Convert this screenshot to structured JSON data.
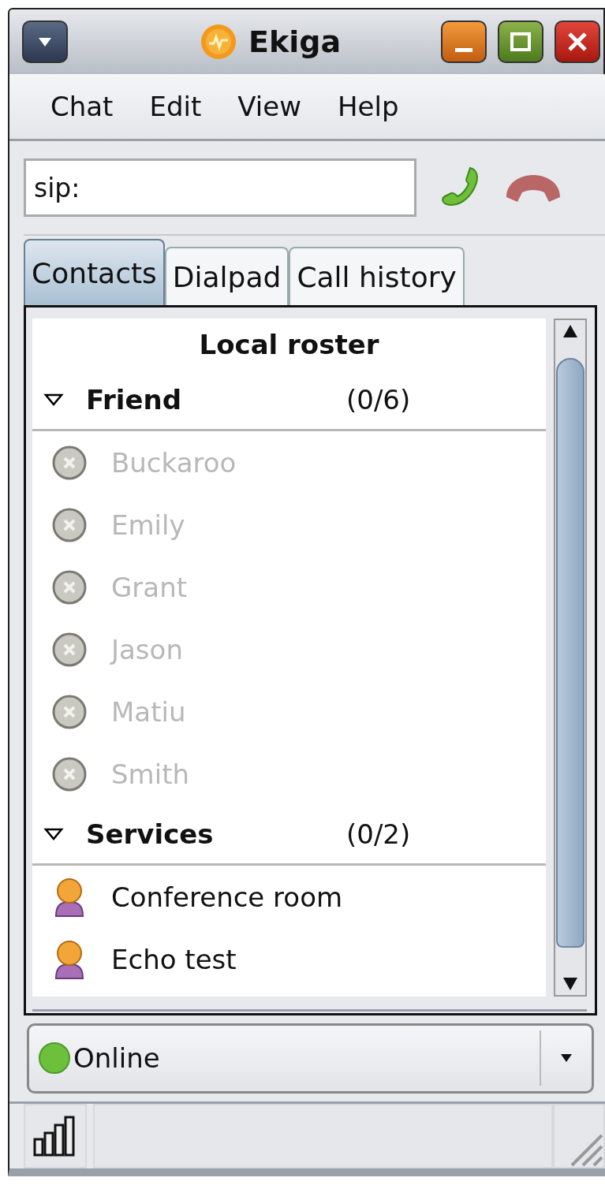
{
  "window": {
    "title": "Ekiga"
  },
  "menu": [
    {
      "label": "Chat"
    },
    {
      "label": "Edit"
    },
    {
      "label": "View"
    },
    {
      "label": "Help"
    }
  ],
  "address": {
    "value": "sip:"
  },
  "tabs": [
    {
      "label": "Contacts",
      "selected": true
    },
    {
      "label": "Dialpad",
      "selected": false
    },
    {
      "label": "Call history",
      "selected": false
    }
  ],
  "roster": {
    "title": "Local roster",
    "groups": [
      {
        "name": "Friend",
        "count": "(0/6)",
        "expanded": true,
        "contacts": [
          {
            "name": "Buckaroo",
            "kind": "offline"
          },
          {
            "name": "Emily",
            "kind": "offline"
          },
          {
            "name": "Grant",
            "kind": "offline"
          },
          {
            "name": "Jason",
            "kind": "offline"
          },
          {
            "name": "Matiu",
            "kind": "offline"
          },
          {
            "name": "Smith",
            "kind": "offline"
          }
        ]
      },
      {
        "name": "Services",
        "count": "(0/2)",
        "expanded": true,
        "contacts": [
          {
            "name": "Conference room",
            "kind": "service"
          },
          {
            "name": "Echo test",
            "kind": "service"
          }
        ]
      }
    ]
  },
  "presence": {
    "label": "Online",
    "color": "#6cc03c"
  }
}
